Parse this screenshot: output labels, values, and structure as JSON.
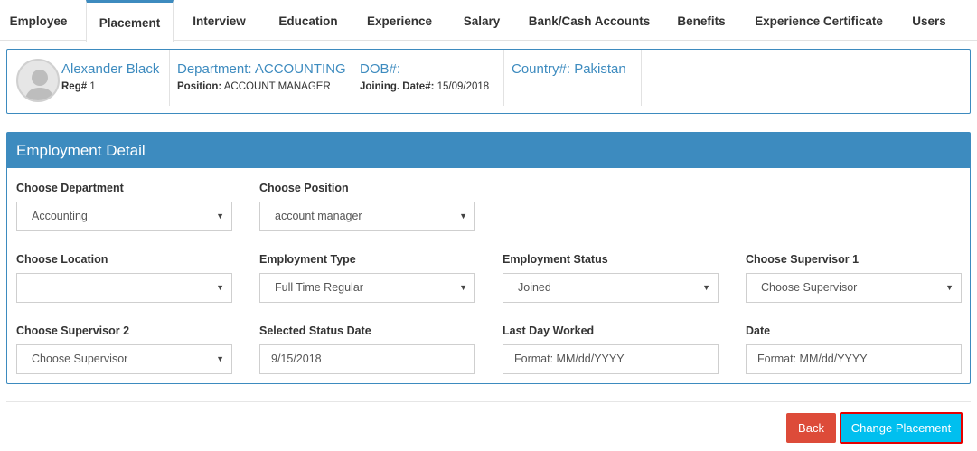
{
  "tabs": [
    {
      "label": "Employee",
      "active": false
    },
    {
      "label": "Placement",
      "active": true
    },
    {
      "label": "Interview",
      "active": false
    },
    {
      "label": "Education",
      "active": false
    },
    {
      "label": "Experience",
      "active": false
    },
    {
      "label": "Salary",
      "active": false
    },
    {
      "label": "Bank/Cash Accounts",
      "active": false
    },
    {
      "label": "Benefits",
      "active": false
    },
    {
      "label": "Experience Certificate",
      "active": false
    },
    {
      "label": "Users",
      "active": false
    }
  ],
  "profile": {
    "name": "Alexander Black",
    "reg_label": "Reg#",
    "reg_value": "1",
    "department": "Department: ACCOUNTING",
    "position_label": "Position:",
    "position_value": "ACCOUNT MANAGER",
    "dob": "DOB#:",
    "joining_label": "Joining. Date#:",
    "joining_value": "15/09/2018",
    "country": "Country#: Pakistan"
  },
  "panel": {
    "title": "Employment Detail",
    "fields": {
      "department": {
        "label": "Choose Department",
        "value": "Accounting"
      },
      "position": {
        "label": "Choose Position",
        "value": "account manager"
      },
      "location": {
        "label": "Choose Location",
        "value": ""
      },
      "employment_type": {
        "label": "Employment Type",
        "value": "Full Time Regular"
      },
      "employment_status": {
        "label": "Employment Status",
        "value": "Joined"
      },
      "supervisor1": {
        "label": "Choose Supervisor 1",
        "value": "Choose Supervisor"
      },
      "supervisor2": {
        "label": "Choose Supervisor 2",
        "value": "Choose Supervisor"
      },
      "status_date": {
        "label": "Selected Status Date",
        "value": "9/15/2018"
      },
      "last_day": {
        "label": "Last Day Worked",
        "placeholder": "Format: MM/dd/YYYY"
      },
      "date": {
        "label": "Date",
        "placeholder": "Format: MM/dd/YYYY"
      }
    }
  },
  "actions": {
    "back": "Back",
    "change": "Change Placement"
  },
  "icons": {
    "caret": "caret-down-icon",
    "avatar": "user-avatar-icon"
  },
  "colors": {
    "primary": "#3d8bbf",
    "back": "#dd4b39",
    "change": "#00bfef",
    "highlight": "#e60000"
  }
}
